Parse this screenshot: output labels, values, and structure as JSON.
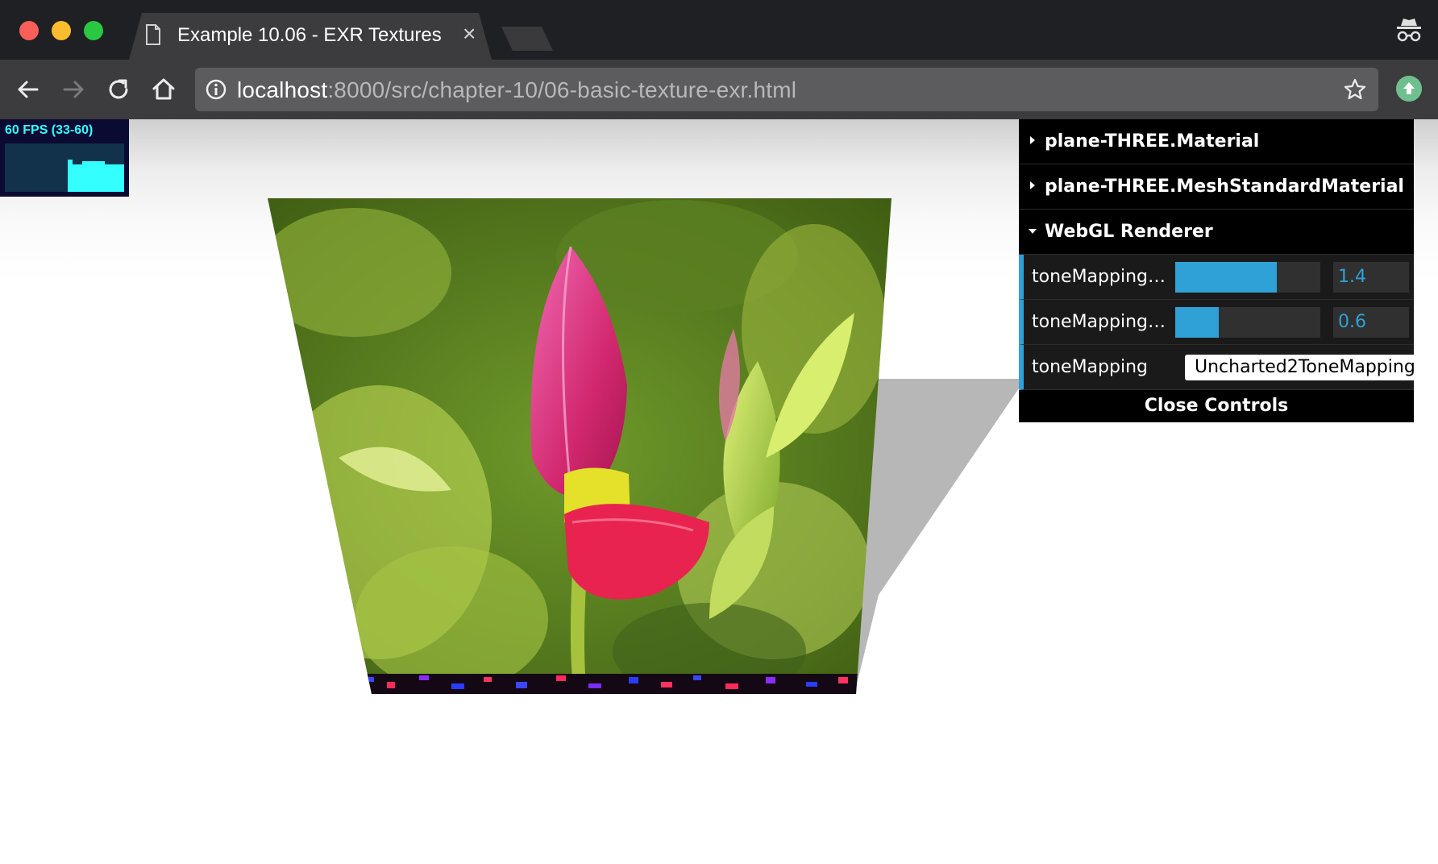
{
  "browser": {
    "tab_title": "Example 10.06 - EXR Textures",
    "tab_close": "×",
    "url_host": "localhost",
    "url_rest": ":8000/src/chapter-10/06-basic-texture-exr.html"
  },
  "stats": {
    "fps_text": "60 FPS (33-60)"
  },
  "gui": {
    "folders": [
      {
        "label": "plane-THREE.Material",
        "open": false
      },
      {
        "label": "plane-THREE.MeshStandardMaterial",
        "open": false
      },
      {
        "label": "WebGL Renderer",
        "open": true
      }
    ],
    "controls": {
      "exposure": {
        "label": "toneMappingE...",
        "value": "1.4",
        "fraction": 0.7
      },
      "whitepoint": {
        "label": "toneMappingW..",
        "value": "0.6",
        "fraction": 0.3
      },
      "tone_mapping": {
        "label": "toneMapping",
        "value": "Uncharted2ToneMapping"
      }
    },
    "close_label": "Close Controls"
  },
  "colors": {
    "accent": "#2fa1d6",
    "fps_cyan": "#33ffff",
    "chrome_dark": "#1f2023",
    "chrome_toolbar": "#3c3c3e"
  },
  "icons": [
    "document-icon",
    "close-icon",
    "incognito-icon",
    "back-icon",
    "forward-icon",
    "reload-icon",
    "home-icon",
    "info-icon",
    "star-icon",
    "extension-icon"
  ]
}
